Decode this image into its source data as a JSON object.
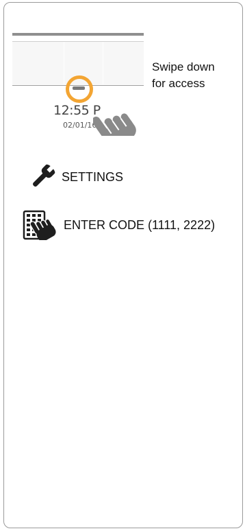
{
  "preview": {
    "time": "12:55 P",
    "date": "02/01/16"
  },
  "instruction": {
    "line1": "Swipe down",
    "line2": "for access"
  },
  "menu": {
    "items": [
      {
        "label": "SETTINGS",
        "icon": "wrench-icon"
      },
      {
        "label": "ENTER CODE (1111, 2222)",
        "icon": "keypad-hand-icon"
      }
    ]
  },
  "colors": {
    "highlight": "#f3a533",
    "hand": "#8a8a8a",
    "text": "#111111"
  }
}
